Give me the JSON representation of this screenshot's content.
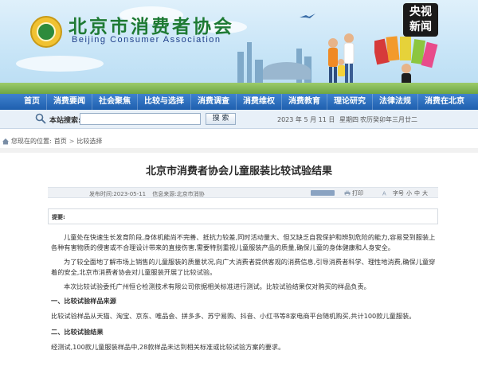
{
  "header": {
    "org_name_cn": "北京市消费者协会",
    "org_name_en": "Beijing Consumer Association",
    "cctv_logo": [
      "央视",
      "新闻"
    ]
  },
  "nav": {
    "items": [
      "首页",
      "消费要闻",
      "社会聚焦",
      "比较与选择",
      "消费调查",
      "消费维权",
      "消费教育",
      "理论研究",
      "法律法规",
      "消费在北京"
    ]
  },
  "search": {
    "label": "本站搜索:",
    "value": "",
    "button": "搜 索",
    "date": "2023 年 5 月 11 日",
    "weekday": "星期四",
    "lunar": "农历癸卯年三月廿二"
  },
  "breadcrumb": {
    "prefix": "您现在的位置:",
    "items": [
      "首页",
      "比较选择"
    ],
    "separator": ">"
  },
  "article": {
    "title": "北京市消费者协会儿童服装比较试验结果",
    "published": "发布时间:2023-05-11",
    "source": "信息来源:北京市消协",
    "print": "打印",
    "zoom_label": "字号",
    "zoom_options": [
      "小",
      "中",
      "大"
    ],
    "summary_label": "提要:",
    "paragraphs": [
      "儿童处在快速生长发育阶段,身体机能尚不完善、抵抗力较差,同时活动量大、但又缺乏自我保护和辨别危险的能力,容易受到服装上各种有害物质的侵害或不合理设计带来的直接伤害,需要特别重视儿童服装产品的质量,确保儿童的身体健康和人身安全。",
      "为了较全面地了解市场上销售的儿童服装的质量状况,向广大消费者提供客观的消费信息,引导消费者科学、理性地消费,确保儿童穿着的安全,北京市消费者协会对儿童服装开展了比较试验。",
      "本次比较试验委托广州恒仑检测技术有限公司依据相关标准进行测试。比较试验结果仅对购买的样品负责。"
    ],
    "section1_heading": "一、比较试验样品来源",
    "section1_text": "比较试验样品从天猫、淘宝、京东、唯品会、拼多多、苏宁易购、抖音、小红书等8家电商平台随机购买,共计100款儿童服装。",
    "section2_heading": "二、比较试验结果",
    "section2_text": "经测试,100款儿童服装样品中,28款样品未达到相关标准或比较试验方案的要求。"
  },
  "colors": {
    "nav_bg": "#2a6fc0",
    "brand_green": "#1e7a33",
    "brand_blue": "#1f3f8a"
  }
}
